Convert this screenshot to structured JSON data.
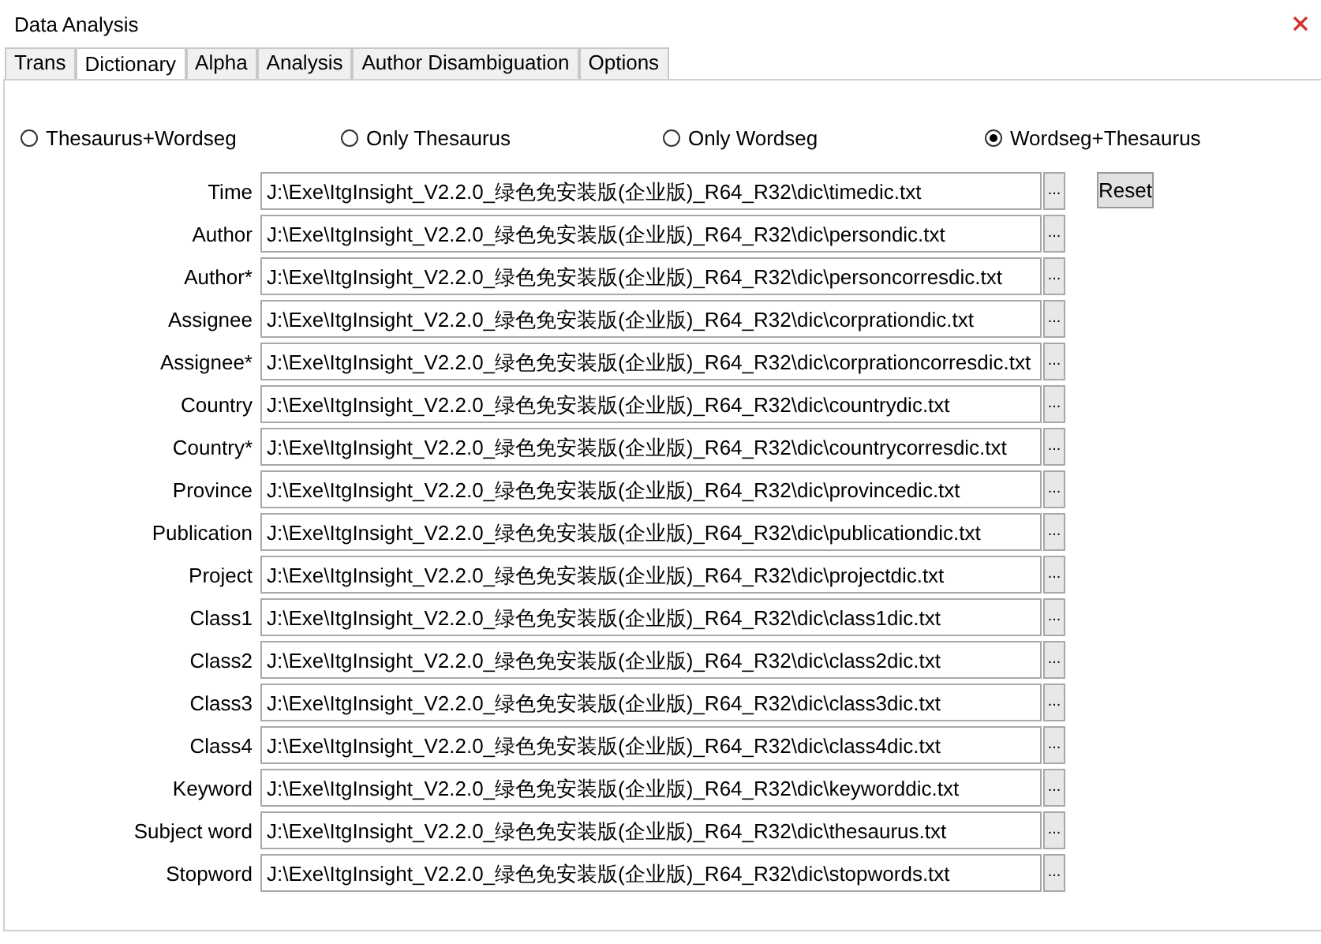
{
  "window": {
    "title": "Data Analysis"
  },
  "tabs": [
    {
      "label": "Trans",
      "selected": false
    },
    {
      "label": "Dictionary",
      "selected": true
    },
    {
      "label": "Alpha",
      "selected": false
    },
    {
      "label": "Analysis",
      "selected": false
    },
    {
      "label": "Author Disambiguation",
      "selected": false
    },
    {
      "label": "Options",
      "selected": false
    }
  ],
  "modes": [
    {
      "label": "Thesaurus+Wordseg",
      "selected": false
    },
    {
      "label": "Only Thesaurus",
      "selected": false
    },
    {
      "label": "Only Wordseg",
      "selected": false
    },
    {
      "label": "Wordseg+Thesaurus",
      "selected": true
    }
  ],
  "reset_button": "Reset",
  "dictionaries": [
    {
      "label": "Time",
      "value": "J:\\Exe\\ItgInsight_V2.2.0_绿色免安装版(企业版)_R64_R32\\dic\\timedic.txt",
      "browse": "..."
    },
    {
      "label": "Author",
      "value": "J:\\Exe\\ItgInsight_V2.2.0_绿色免安装版(企业版)_R64_R32\\dic\\persondic.txt",
      "browse": "..."
    },
    {
      "label": "Author*",
      "value": "J:\\Exe\\ItgInsight_V2.2.0_绿色免安装版(企业版)_R64_R32\\dic\\personcorresdic.txt",
      "browse": "..."
    },
    {
      "label": "Assignee",
      "value": "J:\\Exe\\ItgInsight_V2.2.0_绿色免安装版(企业版)_R64_R32\\dic\\corprationdic.txt",
      "browse": "..."
    },
    {
      "label": "Assignee*",
      "value": "J:\\Exe\\ItgInsight_V2.2.0_绿色免安装版(企业版)_R64_R32\\dic\\corprationcorresdic.txt",
      "browse": "..."
    },
    {
      "label": "Country",
      "value": "J:\\Exe\\ItgInsight_V2.2.0_绿色免安装版(企业版)_R64_R32\\dic\\countrydic.txt",
      "browse": "..."
    },
    {
      "label": "Country*",
      "value": "J:\\Exe\\ItgInsight_V2.2.0_绿色免安装版(企业版)_R64_R32\\dic\\countrycorresdic.txt",
      "browse": "..."
    },
    {
      "label": "Province",
      "value": "J:\\Exe\\ItgInsight_V2.2.0_绿色免安装版(企业版)_R64_R32\\dic\\provincedic.txt",
      "browse": "..."
    },
    {
      "label": "Publication",
      "value": "J:\\Exe\\ItgInsight_V2.2.0_绿色免安装版(企业版)_R64_R32\\dic\\publicationdic.txt",
      "browse": "..."
    },
    {
      "label": "Project",
      "value": "J:\\Exe\\ItgInsight_V2.2.0_绿色免安装版(企业版)_R64_R32\\dic\\projectdic.txt",
      "browse": "..."
    },
    {
      "label": "Class1",
      "value": "J:\\Exe\\ItgInsight_V2.2.0_绿色免安装版(企业版)_R64_R32\\dic\\class1dic.txt",
      "browse": "..."
    },
    {
      "label": "Class2",
      "value": "J:\\Exe\\ItgInsight_V2.2.0_绿色免安装版(企业版)_R64_R32\\dic\\class2dic.txt",
      "browse": "..."
    },
    {
      "label": "Class3",
      "value": "J:\\Exe\\ItgInsight_V2.2.0_绿色免安装版(企业版)_R64_R32\\dic\\class3dic.txt",
      "browse": "..."
    },
    {
      "label": "Class4",
      "value": "J:\\Exe\\ItgInsight_V2.2.0_绿色免安装版(企业版)_R64_R32\\dic\\class4dic.txt",
      "browse": "..."
    },
    {
      "label": "Keyword",
      "value": "J:\\Exe\\ItgInsight_V2.2.0_绿色免安装版(企业版)_R64_R32\\dic\\keyworddic.txt",
      "browse": "..."
    },
    {
      "label": "Subject word",
      "value": "J:\\Exe\\ItgInsight_V2.2.0_绿色免安装版(企业版)_R64_R32\\dic\\thesaurus.txt",
      "browse": "..."
    },
    {
      "label": "Stopword",
      "value": "J:\\Exe\\ItgInsight_V2.2.0_绿色免安装版(企业版)_R64_R32\\dic\\stopwords.txt",
      "browse": "..."
    }
  ]
}
